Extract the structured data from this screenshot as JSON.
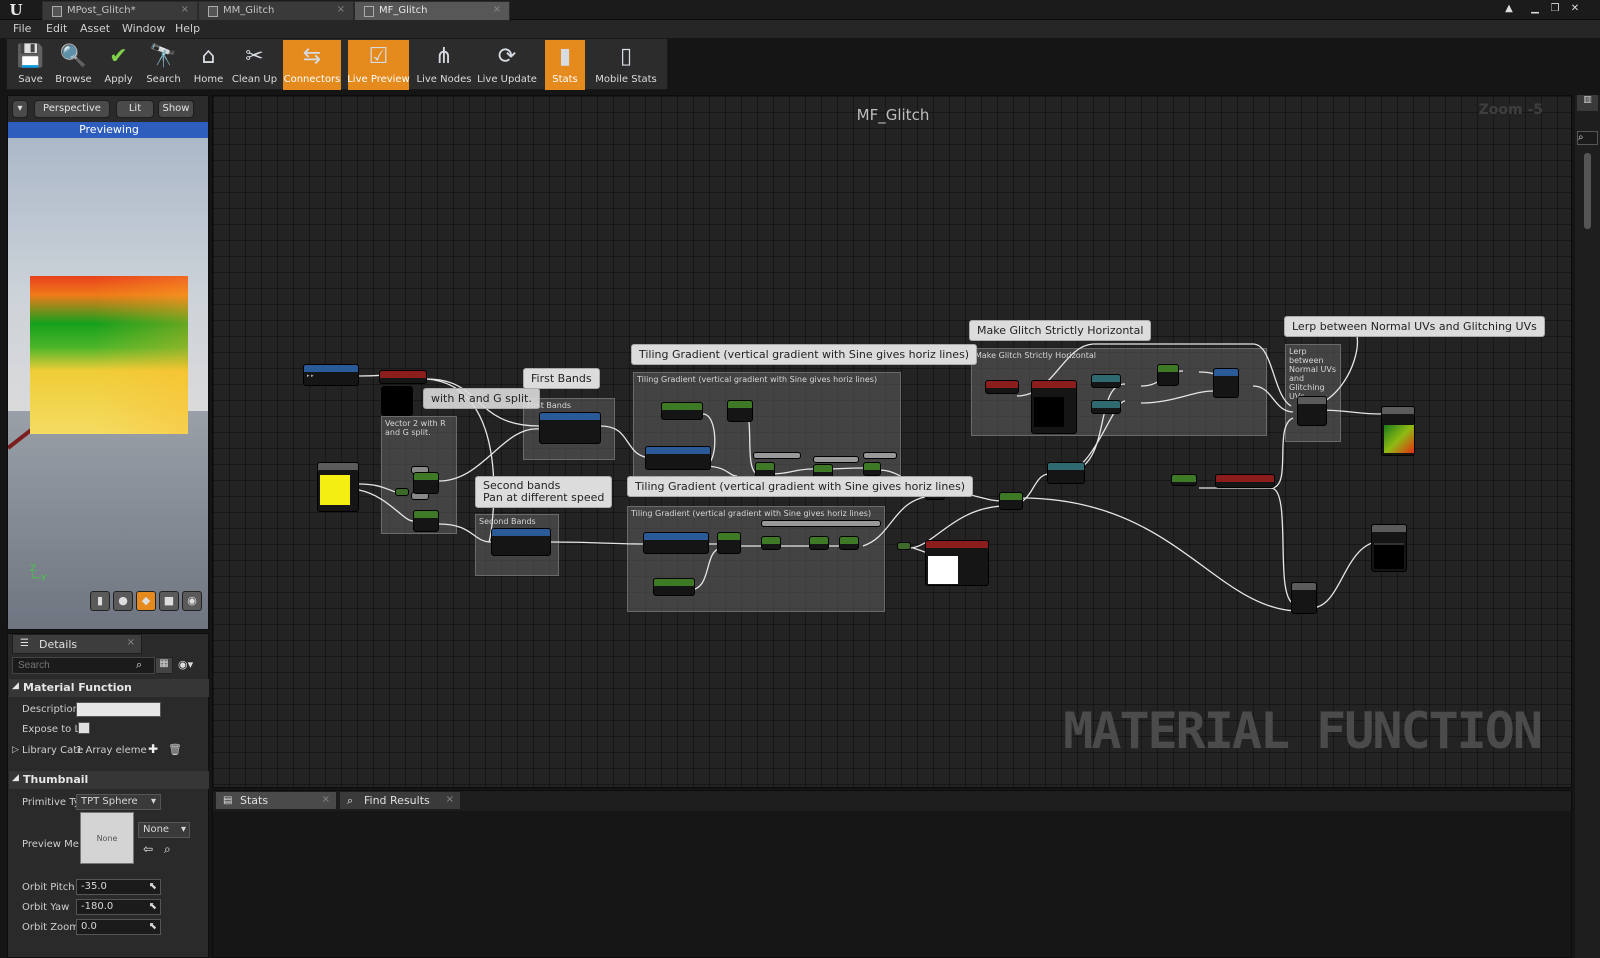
{
  "tabs": [
    {
      "label": "MPost_Glitch*"
    },
    {
      "label": "MM_Glitch"
    },
    {
      "label": "MF_Glitch"
    }
  ],
  "menu": [
    "File",
    "Edit",
    "Asset",
    "Window",
    "Help"
  ],
  "toolbar": [
    {
      "label": "Save",
      "glyph": "💾"
    },
    {
      "label": "Browse",
      "glyph": "🔍"
    },
    {
      "label": "Apply",
      "glyph": "✔"
    },
    {
      "label": "Search",
      "glyph": "🔭"
    },
    {
      "label": "Home",
      "glyph": "⌂"
    },
    {
      "label": "Clean Up",
      "glyph": "✂"
    },
    {
      "label": "Connectors",
      "glyph": "⇆"
    },
    {
      "label": "Live Preview",
      "glyph": "☑"
    },
    {
      "label": "Live Nodes",
      "glyph": "⋔"
    },
    {
      "label": "Live Update",
      "glyph": "⟳"
    },
    {
      "label": "Stats",
      "glyph": "▮"
    },
    {
      "label": "Mobile Stats",
      "glyph": "▯"
    }
  ],
  "viewport": {
    "perspective": "Perspective",
    "lit": "Lit",
    "show": "Show",
    "previewing": "Previewing",
    "axis": "Z\n|_Y"
  },
  "details": {
    "tab": "Details",
    "search_placeholder": "Search",
    "sections": {
      "material_function": "Material Function",
      "thumbnail": "Thumbnail"
    },
    "props": {
      "description": "Description",
      "expose": "Expose to Li",
      "library_cat": "Library Cate",
      "library_val": "1 Array eleme",
      "primitive": "Primitive Ty",
      "primitive_val": "TPT Sphere",
      "preview_mesh": "Preview Me",
      "preview_none": "None",
      "preview_select": "None",
      "orbit_pitch": "Orbit Pitch",
      "orbit_pitch_val": "-35.0",
      "orbit_yaw": "Orbit Yaw",
      "orbit_yaw_val": "-180.0",
      "orbit_zoom": "Orbit Zoom",
      "orbit_zoom_val": "0.0"
    }
  },
  "graph": {
    "title": "MF_Glitch",
    "zoom": "Zoom -5",
    "watermark": "MATERIAL FUNCTION",
    "bubbles": {
      "rg_split": "with R and G split.",
      "first_bands": "First Bands",
      "second_bands": "Second bands\nPan at different speed",
      "tiling1": "Tiling Gradient (vertical gradient with Sine gives horiz lines)",
      "tiling2": "Tiling Gradient (vertical gradient with Sine gives horiz lines)",
      "make_glitch": "Make Glitch Strictly Horizontal",
      "lerp": "Lerp between Normal UVs and Glitching UVs"
    },
    "comments": {
      "vector2": "Vector 2 with R and G split.",
      "first_bands": "First Bands",
      "second_bands": "Second Bands",
      "tiling1": "Tiling Gradient (vertical gradient with Sine gives horiz lines)",
      "tiling2": "Tiling Gradient (vertical gradient with Sine gives horiz lines)",
      "make_glitch": "Make Glitch Strictly Horizontal",
      "lerp": "Lerp between Normal UVs and Glitching UVs"
    }
  },
  "bottom": {
    "tabs": [
      "Stats",
      "Find Results"
    ]
  },
  "colors": {
    "accent": "#e58a1c",
    "preview_blue": "#2d5dbd"
  }
}
